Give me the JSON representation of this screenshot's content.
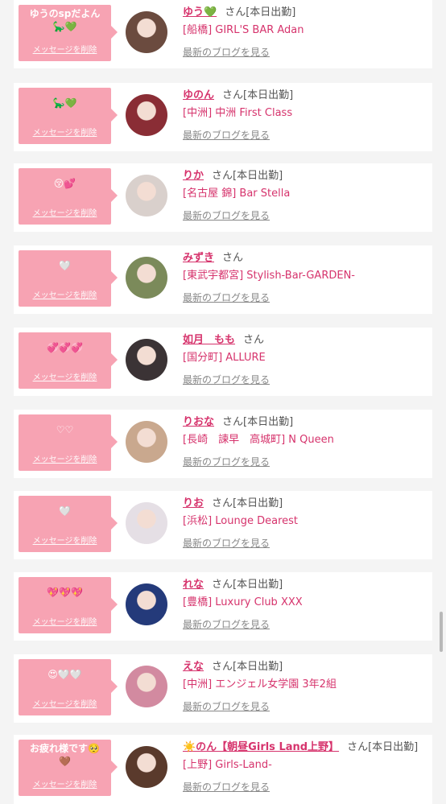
{
  "colors": {
    "bubble": "#f7a3b3",
    "accent": "#d6336c",
    "muted": "#888888"
  },
  "delete_label": "メッセージを削除",
  "blog_label": "最新のブログを見る",
  "suffix": "さん",
  "cards": [
    {
      "msg1": "ゆうのspだよん",
      "msg2": "🦕💚",
      "name": "ゆう💚",
      "status": "[本日出勤]",
      "shop": "[船橋] GIRL'S BAR Adan",
      "avatar_color": "#6b4b3f"
    },
    {
      "msg1": "",
      "msg2": "🦕💚",
      "name": "ゆのん",
      "status": "[本日出勤]",
      "shop": "[中洲] 中洲 First Class",
      "avatar_color": "#8a2d35"
    },
    {
      "msg1": "",
      "msg2": "😚💕",
      "name": "りか",
      "status": "[本日出勤]",
      "shop": "[名古屋 錦] Bar Stella",
      "avatar_color": "#d9d0cc"
    },
    {
      "msg1": "",
      "msg2": "🤍",
      "name": "みずき",
      "status": "",
      "shop": "[東武宇都宮] Stylish-Bar-GARDEN-",
      "avatar_color": "#7b8a5a"
    },
    {
      "msg1": "",
      "msg2": "💞💞💞",
      "name": "如月　もも",
      "status": "",
      "shop": "[国分町] ALLURE",
      "avatar_color": "#3b3335"
    },
    {
      "msg1": "",
      "msg2": "♡♡",
      "name": "りおな",
      "status": "[本日出勤]",
      "shop": "[長崎　諫早　高城町] N Queen",
      "avatar_color": "#c9a88e"
    },
    {
      "msg1": "",
      "msg2": "🤍",
      "name": "りお",
      "status": "[本日出勤]",
      "shop": "[浜松] Lounge Dearest",
      "avatar_color": "#e5dfe5"
    },
    {
      "msg1": "",
      "msg2": "💖💖💖",
      "name": "れな",
      "status": "[本日出勤]",
      "shop": "[豊橋] Luxury Club XXX",
      "avatar_color": "#243a7a"
    },
    {
      "msg1": "",
      "msg2": "😍🤍🤍",
      "name": "えな",
      "status": "[本日出勤]",
      "shop": "[中洲] エンジェル女学園 3年2組",
      "avatar_color": "#d28aa0"
    },
    {
      "msg1": "お疲れ様です🥺",
      "msg2": "🤎",
      "name": "☀️のん【朝昼Girls Land上野】",
      "status": "[本日出勤]",
      "shop": "[上野] Girls-Land-",
      "avatar_color": "#5a3a2c"
    }
  ]
}
